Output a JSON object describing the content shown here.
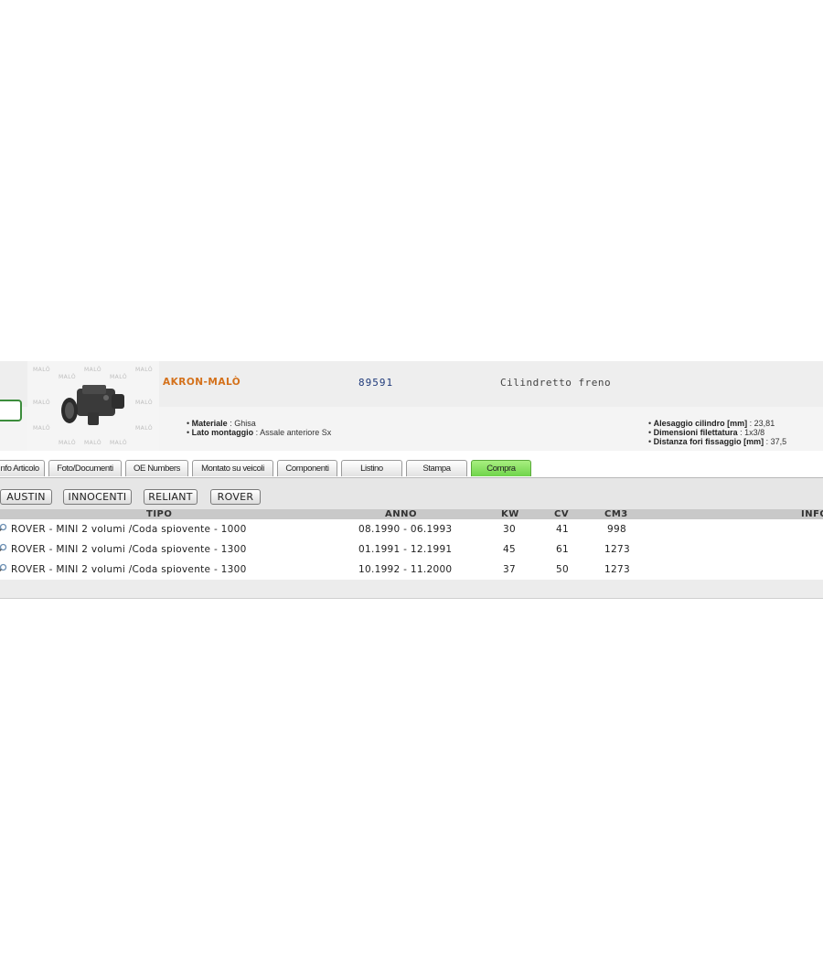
{
  "product": {
    "brand": "AKRON-MALÒ",
    "code": "89591",
    "description": "Cilindretto freno",
    "watermark": "MALÒ"
  },
  "specs_left": [
    {
      "label": "Materiale",
      "value": " : Ghisa"
    },
    {
      "label": "Lato montaggio",
      "value": " : Assale anteriore Sx"
    }
  ],
  "specs_right": [
    {
      "label": "Alesaggio cilindro [mm]",
      "value": " : 23,81"
    },
    {
      "label": "Dimensioni filettatura",
      "value": " : 1x3/8"
    },
    {
      "label": "Distanza fori fissaggio [mm]",
      "value": " : 37,5"
    }
  ],
  "tabs": [
    {
      "label": "Info Articolo"
    },
    {
      "label": "Foto/Documenti"
    },
    {
      "label": "OE Numbers"
    },
    {
      "label": "Montato su veicoli"
    },
    {
      "label": "Componenti"
    },
    {
      "label": "Listino"
    },
    {
      "label": "Stampa"
    },
    {
      "label": "Compra",
      "active": true
    }
  ],
  "makes": [
    "AUSTIN",
    "INNOCENTI",
    "RELIANT",
    "ROVER"
  ],
  "table": {
    "headers": {
      "tipo": "TIPO",
      "anno": "ANNO",
      "kw": "KW",
      "cv": "CV",
      "cm3": "CM3",
      "info": "INFO"
    },
    "rows": [
      {
        "tipo": "ROVER - MINI 2 volumi /Coda spiovente - 1000",
        "anno": "08.1990 - 06.1993",
        "kw": "30",
        "cv": "41",
        "cm3": "998"
      },
      {
        "tipo": "ROVER - MINI 2 volumi /Coda spiovente - 1300",
        "anno": "01.1991 - 12.1991",
        "kw": "45",
        "cv": "61",
        "cm3": "1273"
      },
      {
        "tipo": "ROVER - MINI 2 volumi /Coda spiovente - 1300",
        "anno": "10.1992 - 11.2000",
        "kw": "37",
        "cv": "50",
        "cm3": "1273"
      }
    ]
  },
  "icons": {
    "row_icon": "magnifier-icon"
  },
  "colors": {
    "brand": "#d4711b",
    "code": "#1f3a7a",
    "active_tab": "#6fd44a",
    "accent_box": "#3c8d3c"
  }
}
